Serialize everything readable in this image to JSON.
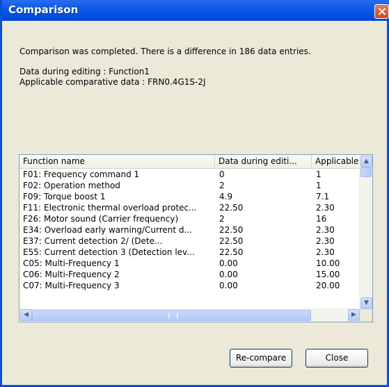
{
  "window": {
    "title": "Comparison"
  },
  "message": {
    "summary": "Comparison was completed. There is a difference in 186 data entries.",
    "editing_line": "Data during editing : Function1",
    "comparative_line": "Applicable comparative data : FRN0.4G1S-2J"
  },
  "table": {
    "columns": [
      "Function name",
      "Data during editi...",
      "Applicable"
    ],
    "rows": [
      [
        "F01: Frequency command 1",
        "0",
        "1"
      ],
      [
        "F02: Operation method",
        "2",
        "1"
      ],
      [
        "F09: Torque boost 1",
        "4.9",
        "7.1"
      ],
      [
        "F11: Electronic thermal overload protec...",
        "22.50",
        "2.30"
      ],
      [
        "F26: Motor sound (Carrier frequency)",
        "2",
        "16"
      ],
      [
        "E34: Overload early warning/Current d...",
        "22.50",
        "2.30"
      ],
      [
        "E37: Current detection 2/          (Dete...",
        "22.50",
        "2.30"
      ],
      [
        "E55: Current detection 3 (Detection lev...",
        "22.50",
        "2.30"
      ],
      [
        "C05: Multi-Frequency 1",
        "0.00",
        "10.00"
      ],
      [
        "C06: Multi-Frequency 2",
        "0.00",
        "15.00"
      ],
      [
        "C07: Multi-Frequency 3",
        "0.00",
        "20.00"
      ]
    ]
  },
  "buttons": {
    "recompare": "Re-compare",
    "close": "Close"
  }
}
